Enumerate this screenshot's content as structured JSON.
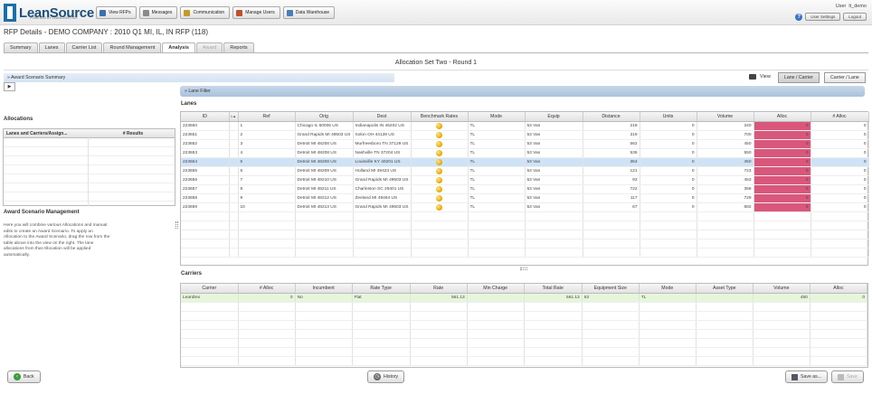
{
  "app": {
    "logo_name": "LeanSource",
    "logo_tagline": "POWERED BY LEANLOGISTICS"
  },
  "nav": [
    {
      "label": "View RFPs",
      "icon": "list-icon",
      "color": "#3a6fb0"
    },
    {
      "label": "Messages",
      "icon": "envelope-icon",
      "color": "#8a8a8a"
    },
    {
      "label": "Communication",
      "icon": "chat-icon",
      "color": "#c49a2c"
    },
    {
      "label": "Manage Users",
      "icon": "users-icon",
      "color": "#c0502a"
    },
    {
      "label": "Data Warehouse",
      "icon": "database-icon",
      "color": "#4a7db8"
    }
  ],
  "user": {
    "label": "User",
    "name": "lt_demo",
    "settings": "User Settings",
    "logout": "Logout"
  },
  "page": {
    "title": "RFP Details - DEMO COMPANY : 2010 Q1 MI, IL, IN RFP (118)"
  },
  "tabs": [
    {
      "label": "Summary"
    },
    {
      "label": "Lanes"
    },
    {
      "label": "Carrier List"
    },
    {
      "label": "Round Management"
    },
    {
      "label": "Analysis"
    },
    {
      "label": "Award"
    },
    {
      "label": "Reports"
    }
  ],
  "set_title": "Allocation Set Two - Round 1",
  "award_summary": "Award Scenario Summary",
  "view": {
    "label": "View",
    "lane_carrier": "Lane / Carrier",
    "carrier_lane": "Carrier / Lane"
  },
  "lane_filter": "Lane Filter",
  "lanes": {
    "label": "Lanes",
    "columns": [
      "ID",
      "Ref",
      "Orig",
      "Dest",
      "Benchmark Rates",
      "Mode",
      "Equip",
      "Distance",
      "Units",
      "Volume",
      "Alloc",
      "# Alloc"
    ],
    "rows": [
      [
        "223650",
        "1",
        "Chicago IL 60006 US",
        "Indianapolis IN 46202 US",
        "TL",
        "53 Van",
        "218",
        "0",
        "340",
        "0",
        "0"
      ],
      [
        "223651",
        "2",
        "Grand Rapids MI 49503 US",
        "Solon OH 44139 US",
        "TL",
        "53 Van",
        "319",
        "0",
        "700",
        "0",
        "0"
      ],
      [
        "223652",
        "3",
        "Detroit MI 48208 US",
        "Murfreesboro TN 37129 US",
        "TL",
        "53 Van",
        "562",
        "0",
        "450",
        "0",
        "0"
      ],
      [
        "223653",
        "4",
        "Detroit MI 48208 US",
        "Nashville TN 37204 US",
        "TL",
        "53 Van",
        "536",
        "0",
        "550",
        "0",
        "0"
      ],
      [
        "223654",
        "5",
        "Detroit MI 48208 US",
        "Louisville KY 40201 US",
        "TL",
        "53 Van",
        "354",
        "0",
        "450",
        "0",
        "0"
      ],
      [
        "223655",
        "6",
        "Detroit MI 48209 US",
        "Holland MI 49423 US",
        "TL",
        "53 Van",
        "121",
        "0",
        "723",
        "0",
        "0"
      ],
      [
        "223656",
        "7",
        "Detroit MI 48210 US",
        "Grand Rapids MI 49503 US",
        "TL",
        "53 Van",
        "93",
        "0",
        "453",
        "0",
        "0"
      ],
      [
        "223657",
        "8",
        "Detroit MI 48211 US",
        "Charleston SC 29401 US",
        "TL",
        "53 Van",
        "722",
        "0",
        "358",
        "0",
        "0"
      ],
      [
        "223658",
        "9",
        "Detroit MI 48212 US",
        "Zeeland MI 49464 US",
        "TL",
        "53 Van",
        "117",
        "0",
        "729",
        "0",
        "0"
      ],
      [
        "223659",
        "10",
        "Detroit MI 48213 US",
        "Grand Rapids MI 49503 US",
        "TL",
        "53 Van",
        "67",
        "0",
        "682",
        "0",
        "0"
      ]
    ]
  },
  "allocations": {
    "label": "Allocations",
    "col1": "Lanes and Carriers/Assign...",
    "col2": "# Results"
  },
  "award_mgmt": {
    "label": "Award Scenario Management",
    "text": "Here you will combine various Allocations and manual edits to create an Award Scenario. To apply an Allocation to the Award Scenario, drag the row from the table above into the view on the right. The lane allocations from that Allocation will be applied automatically."
  },
  "carriers": {
    "label": "Carriers",
    "columns": [
      "Carrier",
      "# Alloc",
      "Incumbent",
      "Rate Type",
      "Rate",
      "Min Charge",
      "Total Rate",
      "Equipment Size",
      "Mode",
      "Asset Type",
      "Volume",
      "Alloc"
    ],
    "rows": [
      [
        "LeanDex",
        "0",
        "No",
        "Flat",
        "561.13",
        "",
        "561.13",
        "53",
        "TL",
        "",
        "450",
        "0"
      ]
    ]
  },
  "buttons": {
    "back": "Back",
    "history": "History",
    "save_as": "Save as...",
    "save": "Save"
  }
}
